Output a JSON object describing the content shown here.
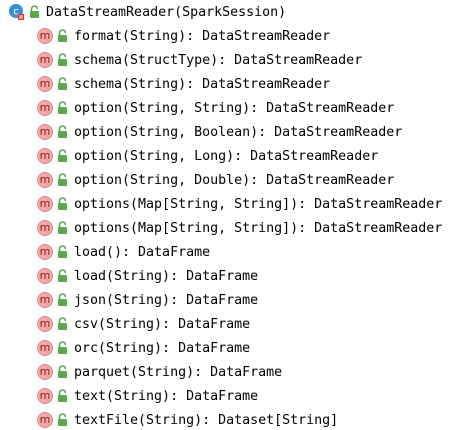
{
  "header": {
    "icon": "class-icon",
    "label": "DataStreamReader(SparkSession)"
  },
  "members": [
    {
      "icon": "m",
      "label": "format(String): DataStreamReader"
    },
    {
      "icon": "m",
      "label": "schema(StructType): DataStreamReader"
    },
    {
      "icon": "m",
      "label": "schema(String): DataStreamReader"
    },
    {
      "icon": "m",
      "label": "option(String, String): DataStreamReader"
    },
    {
      "icon": "m",
      "label": "option(String, Boolean): DataStreamReader"
    },
    {
      "icon": "m",
      "label": "option(String, Long): DataStreamReader"
    },
    {
      "icon": "m",
      "label": "option(String, Double): DataStreamReader"
    },
    {
      "icon": "m",
      "label": "options(Map[String, String]): DataStreamReader"
    },
    {
      "icon": "m",
      "label": "options(Map[String, String]): DataStreamReader"
    },
    {
      "icon": "m",
      "label": "load(): DataFrame"
    },
    {
      "icon": "m",
      "label": "load(String): DataFrame"
    },
    {
      "icon": "m",
      "label": "json(String): DataFrame"
    },
    {
      "icon": "m",
      "label": "csv(String): DataFrame"
    },
    {
      "icon": "m",
      "label": "orc(String): DataFrame"
    },
    {
      "icon": "m",
      "label": "parquet(String): DataFrame"
    },
    {
      "icon": "m",
      "label": "text(String): DataFrame"
    },
    {
      "icon": "m",
      "label": "textFile(String): Dataset[String]"
    }
  ],
  "colors": {
    "method_icon_bg": "#f4aaa6",
    "lock_green": "#5aa84a",
    "class_icon_blue": "#3d8fcf"
  }
}
